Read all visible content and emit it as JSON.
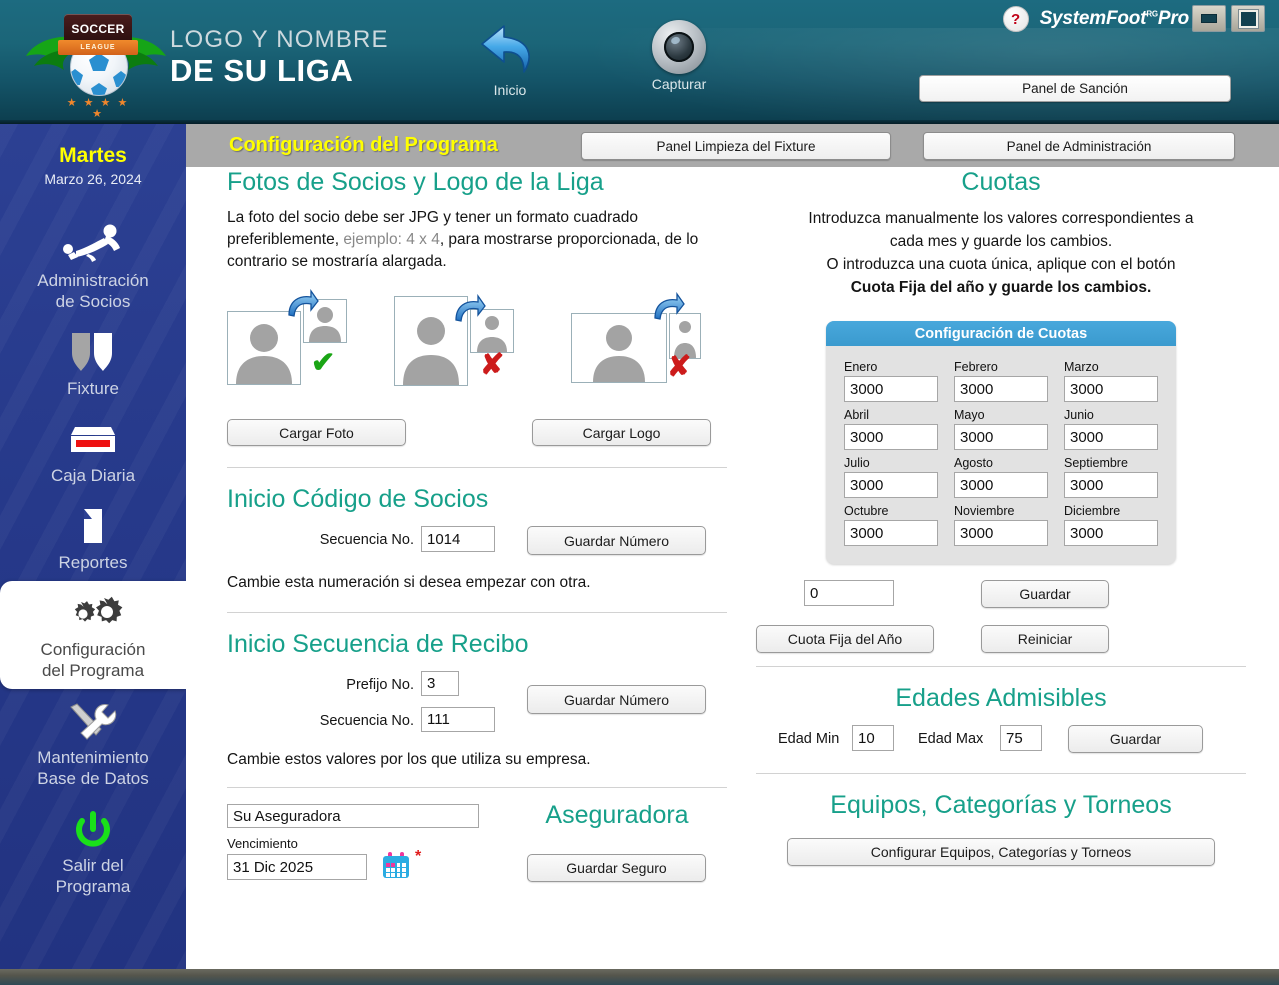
{
  "header": {
    "crest": {
      "top_text": "SOCCER",
      "ribbon_text": "LEAGUE",
      "stars": "★ ★ ★ ★ ★"
    },
    "league_line1": "LOGO Y NOMBRE",
    "league_line2": "DE SU LIGA",
    "nav": [
      {
        "name": "inicio",
        "label": "Inicio",
        "icon": "back-arrow-icon"
      },
      {
        "name": "capturar",
        "label": "Capturar",
        "icon": "camera-icon"
      }
    ],
    "help_icon": "?",
    "brand": "SystemFoot",
    "brand_sup": "RG",
    "brand_suffix": "Pro",
    "window_buttons": [
      "minimize-icon",
      "maximize-icon"
    ],
    "sancion_button": "Panel de Sanción"
  },
  "sidebar": {
    "day": "Martes",
    "date": "Marzo 26, 2024",
    "items": [
      {
        "label": "Administración\nde Socios",
        "l1": "Administración",
        "l2": "de Socios",
        "icon": "player-slide-icon",
        "active": false
      },
      {
        "label": "Fixture",
        "l1": "Fixture",
        "l2": "",
        "icon": "shields-icon",
        "active": false
      },
      {
        "label": "Caja Diaria",
        "l1": "Caja Diaria",
        "l2": "",
        "icon": "cash-drawer-icon",
        "active": false
      },
      {
        "label": "Reportes",
        "l1": "Reportes",
        "l2": "",
        "icon": "document-icon",
        "active": false
      },
      {
        "label": "Configuración del Programa",
        "l1": "Configuración",
        "l2": "del Programa",
        "icon": "gears-icon",
        "active": true
      },
      {
        "label": "Mantenimiento Base de Datos",
        "l1": "Mantenimiento",
        "l2": "Base de Datos",
        "icon": "tools-icon",
        "active": false
      },
      {
        "label": "Salir del Programa",
        "l1": "Salir del",
        "l2": "Programa",
        "icon": "power-icon",
        "active": false
      }
    ]
  },
  "toolbar": {
    "title": "Configuración del Programa",
    "fixture_button": "Panel Limpieza del Fixture",
    "admin_button": "Panel de Administración"
  },
  "fotos": {
    "heading": "Fotos de Socios y Logo de la Liga",
    "desc_1": "La foto del socio debe ser JPG y tener un formato cuadrado preferiblemente, ",
    "desc_muted": "ejemplo: 4 x 4",
    "desc_2": ", para mostrarse proporcionada, de lo contrario se mostraría alargada.",
    "examples": [
      {
        "shape": "square",
        "mark": "✔",
        "valid": true
      },
      {
        "shape": "portrait",
        "mark": "✘",
        "valid": false
      },
      {
        "shape": "landscape",
        "mark": "✘",
        "valid": false
      }
    ],
    "cargar_foto_button": "Cargar Foto",
    "cargar_logo_button": "Cargar Logo"
  },
  "codigo_socios": {
    "heading": "Inicio Código de Socios",
    "secuencia_label": "Secuencia No.",
    "secuencia_value": "1014",
    "save_button": "Guardar Número",
    "note": "Cambie esta numeración si desea empezar con otra."
  },
  "secuencia_recibo": {
    "heading": "Inicio Secuencia de Recibo",
    "prefijo_label": "Prefijo No.",
    "prefijo_value": "3",
    "secuencia_label": "Secuencia No.",
    "secuencia_value": "111",
    "save_button": "Guardar Número",
    "note": "Cambie estos valores por los que utiliza su empresa."
  },
  "aseguradora": {
    "heading": "Aseguradora",
    "name_value": "Su Aseguradora",
    "vencimiento_label": "Vencimiento",
    "vencimiento_value": "31 Dic 2025",
    "calendar_icon": "calendar-icon",
    "required_mark": "*",
    "save_button": "Guardar Seguro"
  },
  "cuotas": {
    "heading": "Cuotas",
    "desc_line1": "Introduzca manualmente los valores correspondientes a",
    "desc_line2": "cada mes y guarde los cambios.",
    "desc_line3": "O introduzca una cuota única, aplique con el botón",
    "desc_line4": "Cuota Fija del año y guarde los cambios.",
    "panel_title": "Configuración de Cuotas",
    "months": [
      {
        "label": "Enero",
        "value": "3000"
      },
      {
        "label": "Febrero",
        "value": "3000"
      },
      {
        "label": "Marzo",
        "value": "3000"
      },
      {
        "label": "Abril",
        "value": "3000"
      },
      {
        "label": "Mayo",
        "value": "3000"
      },
      {
        "label": "Junio",
        "value": "3000"
      },
      {
        "label": "Julio",
        "value": "3000"
      },
      {
        "label": "Agosto",
        "value": "3000"
      },
      {
        "label": "Septiembre",
        "value": "3000"
      },
      {
        "label": "Octubre",
        "value": "3000"
      },
      {
        "label": "Noviembre",
        "value": "3000"
      },
      {
        "label": "Diciembre",
        "value": "3000"
      }
    ],
    "fija_value": "0",
    "guardar_button": "Guardar",
    "cuota_fija_button": "Cuota Fija del Año",
    "reiniciar_button": "Reiniciar"
  },
  "edades": {
    "heading": "Edades Admisibles",
    "min_label": "Edad Min",
    "min_value": "10",
    "max_label": "Edad Max",
    "max_value": "75",
    "save_button": "Guardar"
  },
  "equipos": {
    "heading": "Equipos, Categorías y Torneos",
    "config_button": "Configurar Equipos, Categorías y Torneos"
  },
  "colors": {
    "header_teal": "#1d6b80",
    "sidebar_blue": "#26398a",
    "accent_teal": "#17a08a",
    "title_yellow": "#ffff00",
    "panel_blue": "#3a9ace",
    "ok_green": "#1aa515",
    "error_red": "#cc1b1b"
  }
}
